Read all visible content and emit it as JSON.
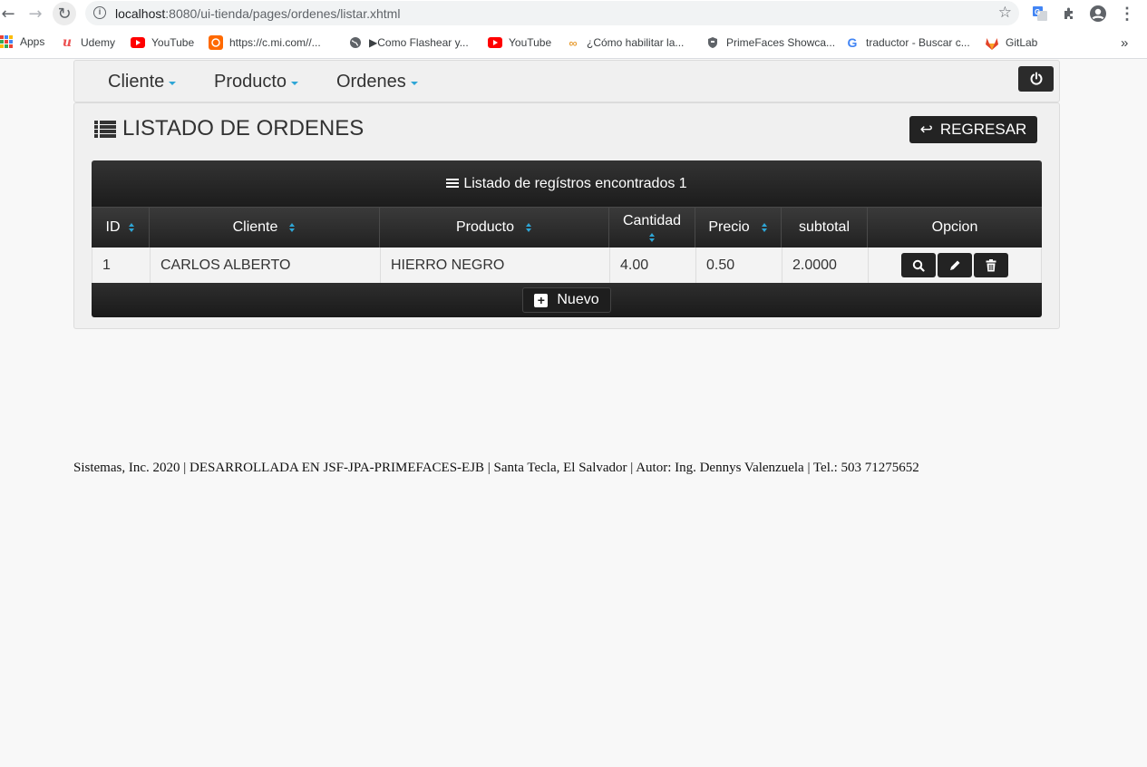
{
  "browser": {
    "url_host": "localhost",
    "url_rest": ":8080/ui-tienda/pages/ordenes/listar.xhtml",
    "bookmarks": [
      {
        "label": "Apps",
        "icon": "apps-grid-icon"
      },
      {
        "label": "Udemy",
        "icon": "udemy-icon"
      },
      {
        "label": "YouTube",
        "icon": "youtube-icon"
      },
      {
        "label": "https://c.mi.com//...",
        "icon": "mi-icon"
      },
      {
        "label": "▶Como Flashear y...",
        "icon": "globe-icon"
      },
      {
        "label": "YouTube",
        "icon": "youtube-icon"
      },
      {
        "label": "¿Cómo habilitar la...",
        "icon": "link-icon"
      },
      {
        "label": "PrimeFaces Showca...",
        "icon": "primefaces-icon"
      },
      {
        "label": "traductor - Buscar c...",
        "icon": "google-icon"
      },
      {
        "label": "GitLab",
        "icon": "gitlab-icon"
      }
    ],
    "more_label": "»"
  },
  "menubar": {
    "items": [
      {
        "label": "Cliente"
      },
      {
        "label": "Producto"
      },
      {
        "label": "Ordenes"
      }
    ]
  },
  "panel": {
    "title": "LISTADO DE ORDENES",
    "back_label": "REGRESAR"
  },
  "table": {
    "header": "Listado de regístros encontrados 1",
    "columns": [
      "ID",
      "Cliente",
      "Producto",
      "Cantidad",
      "Precio",
      "subtotal",
      "Opcion"
    ],
    "rows": [
      {
        "id": "1",
        "cliente": "CARLOS ALBERTO",
        "producto": "HIERRO NEGRO",
        "cantidad": "4.00",
        "precio": "0.50",
        "subtotal": "2.0000"
      }
    ],
    "new_label": "Nuevo"
  },
  "footer": {
    "text": "Sistemas, Inc. 2020 | DESARROLLADA EN JSF-JPA-PRIMEFACES-EJB | Santa Tecla, El Salvador | Autor: Ing. Dennys Valenzuela | Tel.: 503 71275652"
  },
  "colors": {
    "accent": "#2ea6d6",
    "dark_button": "#232323",
    "table_header": "#2a2a2a"
  }
}
